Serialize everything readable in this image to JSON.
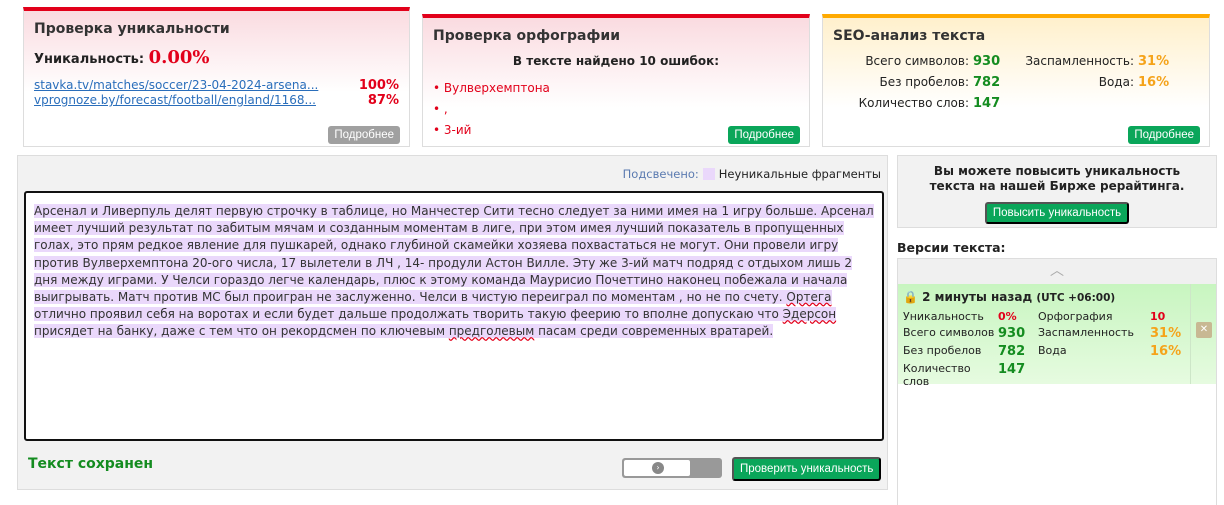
{
  "uniqueness": {
    "title": "Проверка уникальности",
    "label": "Уникальность:",
    "value": "0.00%",
    "sources": [
      {
        "url": "stavka.tv/matches/soccer/23-04-2024-arsena...",
        "pct": "100%"
      },
      {
        "url": "vprognoze.by/forecast/football/england/1168...",
        "pct": "87%"
      }
    ],
    "more": "Подробнее"
  },
  "spelling": {
    "title": "Проверка орфографии",
    "summary": "В тексте найдено 10 ошибок:",
    "errors": [
      "Вулверхемптона",
      ",",
      "3-ий"
    ],
    "more": "Подробнее"
  },
  "seo": {
    "title": "SEO-анализ текста",
    "total_label": "Всего символов:",
    "total": "930",
    "nospace_label": "Без пробелов:",
    "nospace": "782",
    "words_label": "Количество слов:",
    "words": "147",
    "spam_label": "Заспамленность:",
    "spam": "31%",
    "water_label": "Вода:",
    "water": "16%",
    "more": "Подробнее"
  },
  "editor": {
    "legend_label": "Подсвечено:",
    "legend_text": "Неуникальные фрагменты",
    "segments": [
      "Арсенал и Ливерпуль делят первую строчку в таблице, но Манчестер Сити тесно следует за ними имея на 1 игру больше. Арсенал имеет лучший результат по забитым мячам и созданным моментам в лиге, при этом имея лучший показатель в пропущенных голах, это прям редкое явление для пушкарей, однако глубиной скамейки хозяева похвастаться не могут. Они провели игру против Вулверхемптона 20-ого числа, 17 вылетели в ЛЧ , 14- продули Астон Вилле. Эту же 3-ий матч подряд с отдыхом лишь 2 дня между играми. У Челси гораздо легче календарь, плюс к этому команда Маурисио Почеттино наконец побежала и начала выигрывать. Матч против МС был проигран не заслуженно. Челси в чистую переиграл по моментам , но не по счету. ",
      "Ортега",
      " отлично проявил себя на воротах и если будет дальше продолжать творить такую феерию то вполне допускаю что ",
      "Эдерсон",
      " присядет на банку, даже с тем что он рекордсмен по ключевым ",
      "предголевым",
      " пасам среди современных вратарей."
    ],
    "status": "Текст сохранен",
    "check_button": "Проверить уникальность"
  },
  "promo": {
    "text": "Вы можете повысить уникальность текста на нашей Бирже рерайтинга.",
    "button": "Повысить уникальность"
  },
  "versions": {
    "title": "Версии текста:",
    "items": [
      {
        "time": "2 минуты назад",
        "tz": "(UTC +06:00)",
        "uniq_label": "Уникальность",
        "uniq": "0%",
        "spell_label": "Орфография",
        "spell": "10",
        "total_label": "Всего символов",
        "total": "930",
        "spam_label": "Заспамленность",
        "spam": "31%",
        "nospace_label": "Без пробелов",
        "nospace": "782",
        "water_label": "Вода",
        "water": "16%",
        "words_label": "Количество слов",
        "words": "147"
      }
    ]
  },
  "colors": {
    "accent_red": "#e2001a",
    "green": "#0aa65a",
    "orange": "#f5a31a",
    "highlight": "#ead8fb"
  }
}
